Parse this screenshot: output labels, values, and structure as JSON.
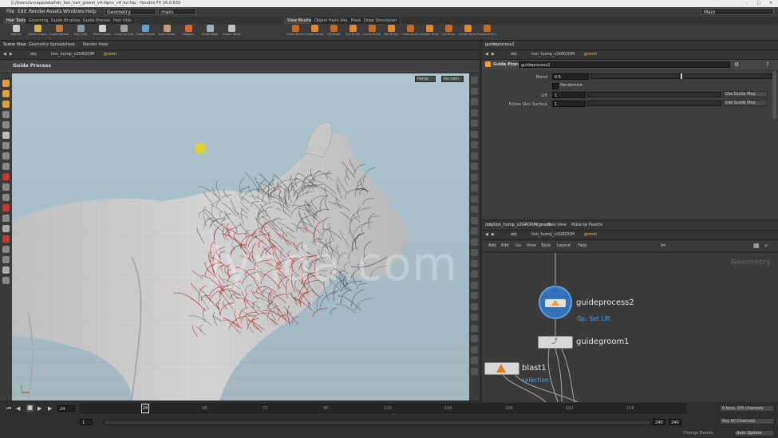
{
  "window": {
    "title": "C:/Users/ivo/appdata/hdc_lion_hair_groom_v4.hipnc_v4_fur.hip - Houdini FX 16.0.633"
  },
  "menu": {
    "items": [
      "File",
      "Edit",
      "Render",
      "Assets",
      "Windows",
      "Help"
    ],
    "desktop": "Geometry",
    "context": "main",
    "user": "Main"
  },
  "shelf": {
    "left_tabs": [
      "Hair Tools",
      "Grooming",
      "Guide Brushes",
      "Guide Process",
      "Hair Utils"
    ],
    "right_tabs": [
      "View Brushes",
      "Object Hairs Volume",
      "Mask",
      "Draw Simulation"
    ],
    "left_tools": [
      "Add Fur",
      "Guide Groom",
      "Guide Deform",
      "Hair Card",
      "Plant Guides",
      "Curve to Guide",
      "Guide Process",
      "Fuzz Guides",
      "Hairgen",
      "Guide Mask",
      "Groom Attrib"
    ],
    "right_tools": [
      "Guide Brush",
      "Screen Brush",
      "Lift Brush",
      "Curl Brush",
      "Clump Brush",
      "Part Brush",
      "Comb Brush",
      "Smooth Brush",
      "Cut Brush",
      "Length Brush",
      "Pushbush Brush"
    ]
  },
  "scene_view": {
    "tabs": [
      "Scene View",
      "Geometry Spreadsheet",
      "Render View"
    ],
    "path": [
      "obj",
      "lion_hump_v2GROOM",
      "groom"
    ],
    "tool_title": "Guide Process",
    "camera_btn": "Persp",
    "display_btn": "No cam"
  },
  "params": {
    "tabs": [
      "guideprocess2"
    ],
    "path": [
      "obj",
      "lion_hump_v2GROOM",
      "groom"
    ],
    "node_type": "Guide Process",
    "node_name": "guideprocess2",
    "rows": [
      {
        "label": "Blend",
        "value": "0.5"
      },
      {
        "label": "Randomize",
        "value": ""
      },
      {
        "label": "Lift",
        "value": "1",
        "button": "Use Guide Map"
      },
      {
        "label": "Follow Skin Surface",
        "value": "1",
        "button": "Use Guide Map"
      }
    ]
  },
  "network": {
    "tabs": [
      "/obj/lion_hump_v2GROOM/groom",
      "Tree View",
      "Material Palette"
    ],
    "path": [
      "obj",
      "lion_hump_v2GROOM",
      "groom"
    ],
    "menu": [
      "Add",
      "Edit",
      "Go",
      "View",
      "Tools",
      "Layout",
      "Help"
    ],
    "context_label": "Geometry",
    "nodes": [
      {
        "name": "guideprocess2",
        "sub": "Op: Set Lift"
      },
      {
        "name": "guidegroom1",
        "sub": ""
      },
      {
        "name": "blast1",
        "sub": "selection"
      }
    ]
  },
  "timeline": {
    "current_frame": "24",
    "start": "1",
    "end": "240",
    "end2": "240",
    "ticks": [
      "24",
      "48",
      "72",
      "96",
      "120",
      "144",
      "168",
      "192",
      "216"
    ],
    "keys_btn": "0 keys, 0/0 channels",
    "key_all": "Key All Channels",
    "auto_update": "Auto Update",
    "keyframe_label": "Change Events"
  },
  "watermark": "lynda.com",
  "colors": {
    "accent": "#f0a030",
    "link": "#4ea1e0",
    "hair_red": "#b01010"
  }
}
